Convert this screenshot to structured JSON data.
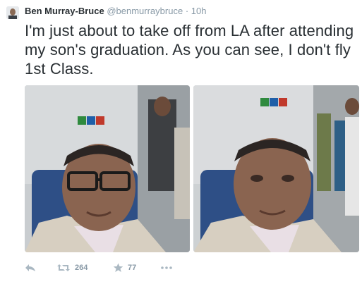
{
  "tweet": {
    "author_name": "Ben Murray-Bruce",
    "handle": "@benmurraybruce",
    "separator": "·",
    "time": "10h",
    "text": "I'm just about to take off from LA after attending my son's graduation. As you can see, I don't fly 1st Class."
  },
  "actions": {
    "reply_icon": "reply-icon",
    "retweet_icon": "retweet-icon",
    "retweet_count": "264",
    "favorite_icon": "star-icon",
    "favorite_count": "77",
    "more_icon": "more-dots-icon"
  },
  "colors": {
    "text": "#292f33",
    "secondary": "#8899a6",
    "icon": "#aab8c2",
    "background": "#ffffff"
  }
}
